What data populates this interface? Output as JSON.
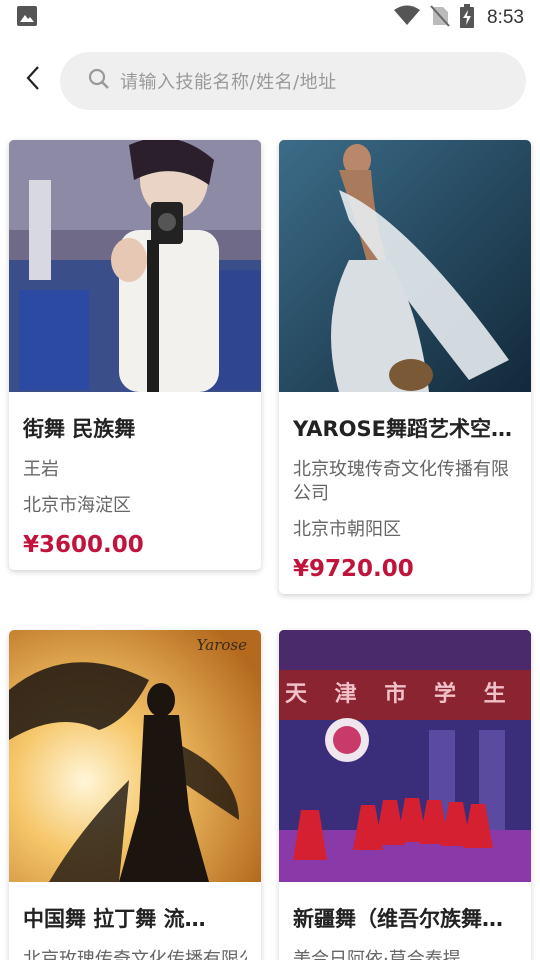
{
  "status_bar": {
    "time": "8:53",
    "icons": [
      "image-icon",
      "wifi-icon",
      "no-sim-icon",
      "battery-charging-icon"
    ]
  },
  "search": {
    "placeholder": "请输入技能名称/姓名/地址"
  },
  "cards": [
    {
      "title": "街舞 民族舞",
      "name": "王岩",
      "address": "北京市海淀区",
      "price": "¥3600.00",
      "image": "photo of dancer taking mirror selfie"
    },
    {
      "title": "YAROSE舞蹈艺术空…",
      "name": "北京玫瑰传奇文化传播有限公司",
      "address": "北京市朝阳区",
      "price": "¥9720.00",
      "image": "photo of belly dancer with white veil"
    },
    {
      "title": "中国舞  拉丁舞   流…",
      "name": "北京玫瑰传奇文化传播有限公司",
      "address": "",
      "price": "",
      "image": "silhouette of dancer at sunset",
      "watermark": "Yarose"
    },
    {
      "title": "新疆舞（维吾尔族舞…",
      "name": "美合日阿依·莫合泰提",
      "address": "",
      "price": "",
      "image": "stage performance",
      "banner": "天 津 市 学 生 舞"
    }
  ],
  "colors": {
    "price": "#c0143c",
    "search_bg": "#efefef"
  }
}
